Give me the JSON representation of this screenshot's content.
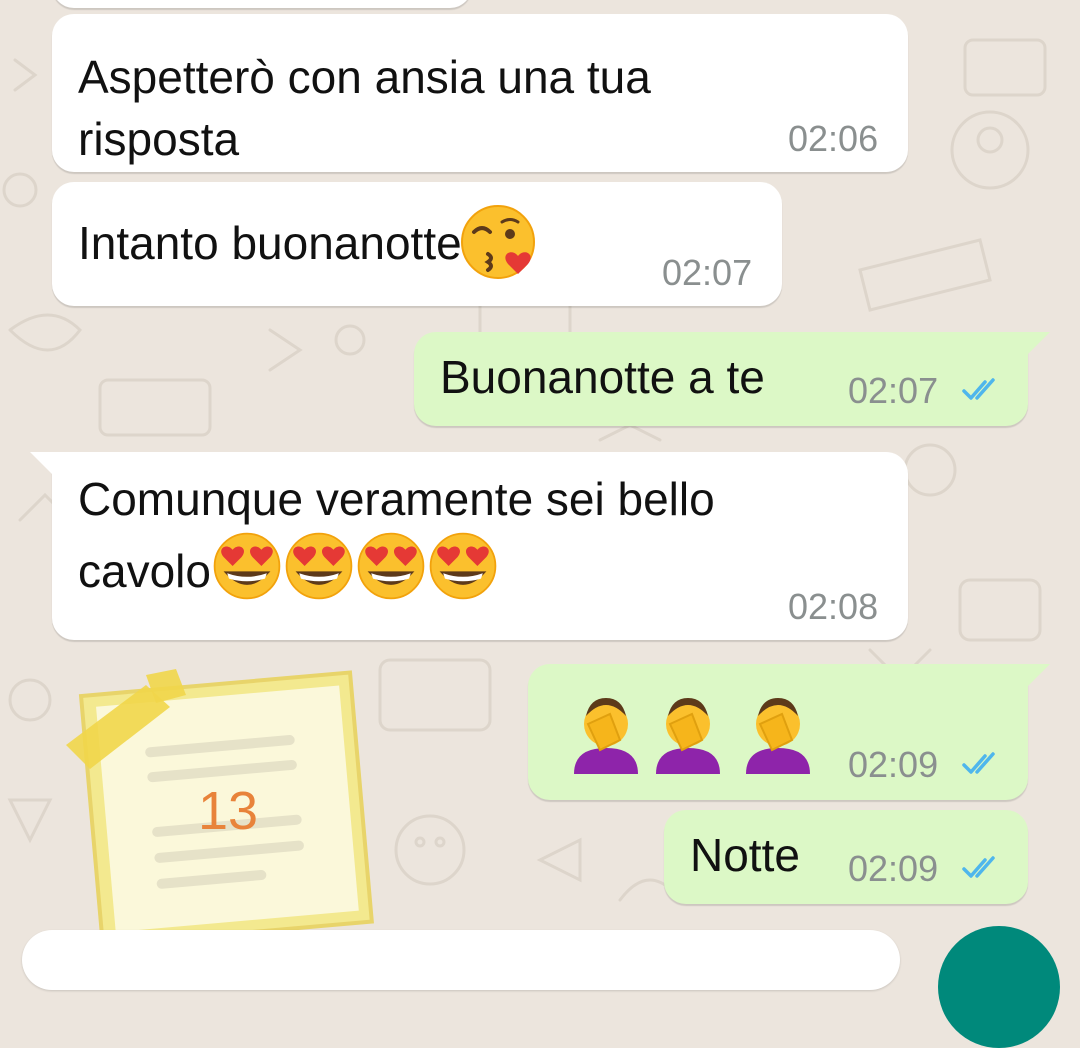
{
  "chat": {
    "messages": [
      {
        "direction": "incoming",
        "text_line1": "Aspetterò con ansia una tua",
        "text_line2": "risposta",
        "time": "02:06"
      },
      {
        "direction": "incoming",
        "text": "Intanto buonanotte",
        "emoji": "face-blowing-a-kiss",
        "time": "02:07"
      },
      {
        "direction": "outgoing",
        "text": "Buonanotte a te",
        "time": "02:07",
        "status": "read"
      },
      {
        "direction": "incoming",
        "text_line1": "Comunque veramente sei  bello",
        "text_line2": "cavolo",
        "emoji": "smiling-face-with-heart-eyes",
        "emoji_count": 4,
        "time": "02:08"
      },
      {
        "direction": "outgoing",
        "emoji": "person-facepalming",
        "emoji_count": 3,
        "time": "02:09",
        "status": "read"
      },
      {
        "direction": "outgoing",
        "text": "Notte",
        "time": "02:09",
        "status": "read"
      }
    ],
    "sticker": {
      "label": "13",
      "type": "sticky-note-calendar"
    }
  },
  "colors": {
    "background": "#ece5dd",
    "incoming_bubble": "#ffffff",
    "outgoing_bubble": "#dcf8c6",
    "read_tick": "#4fb6ec",
    "timestamp": "#8a8f8f",
    "send_button": "#00897b"
  },
  "icons": {
    "read_receipt": "double-check-icon",
    "send": "send-button"
  }
}
